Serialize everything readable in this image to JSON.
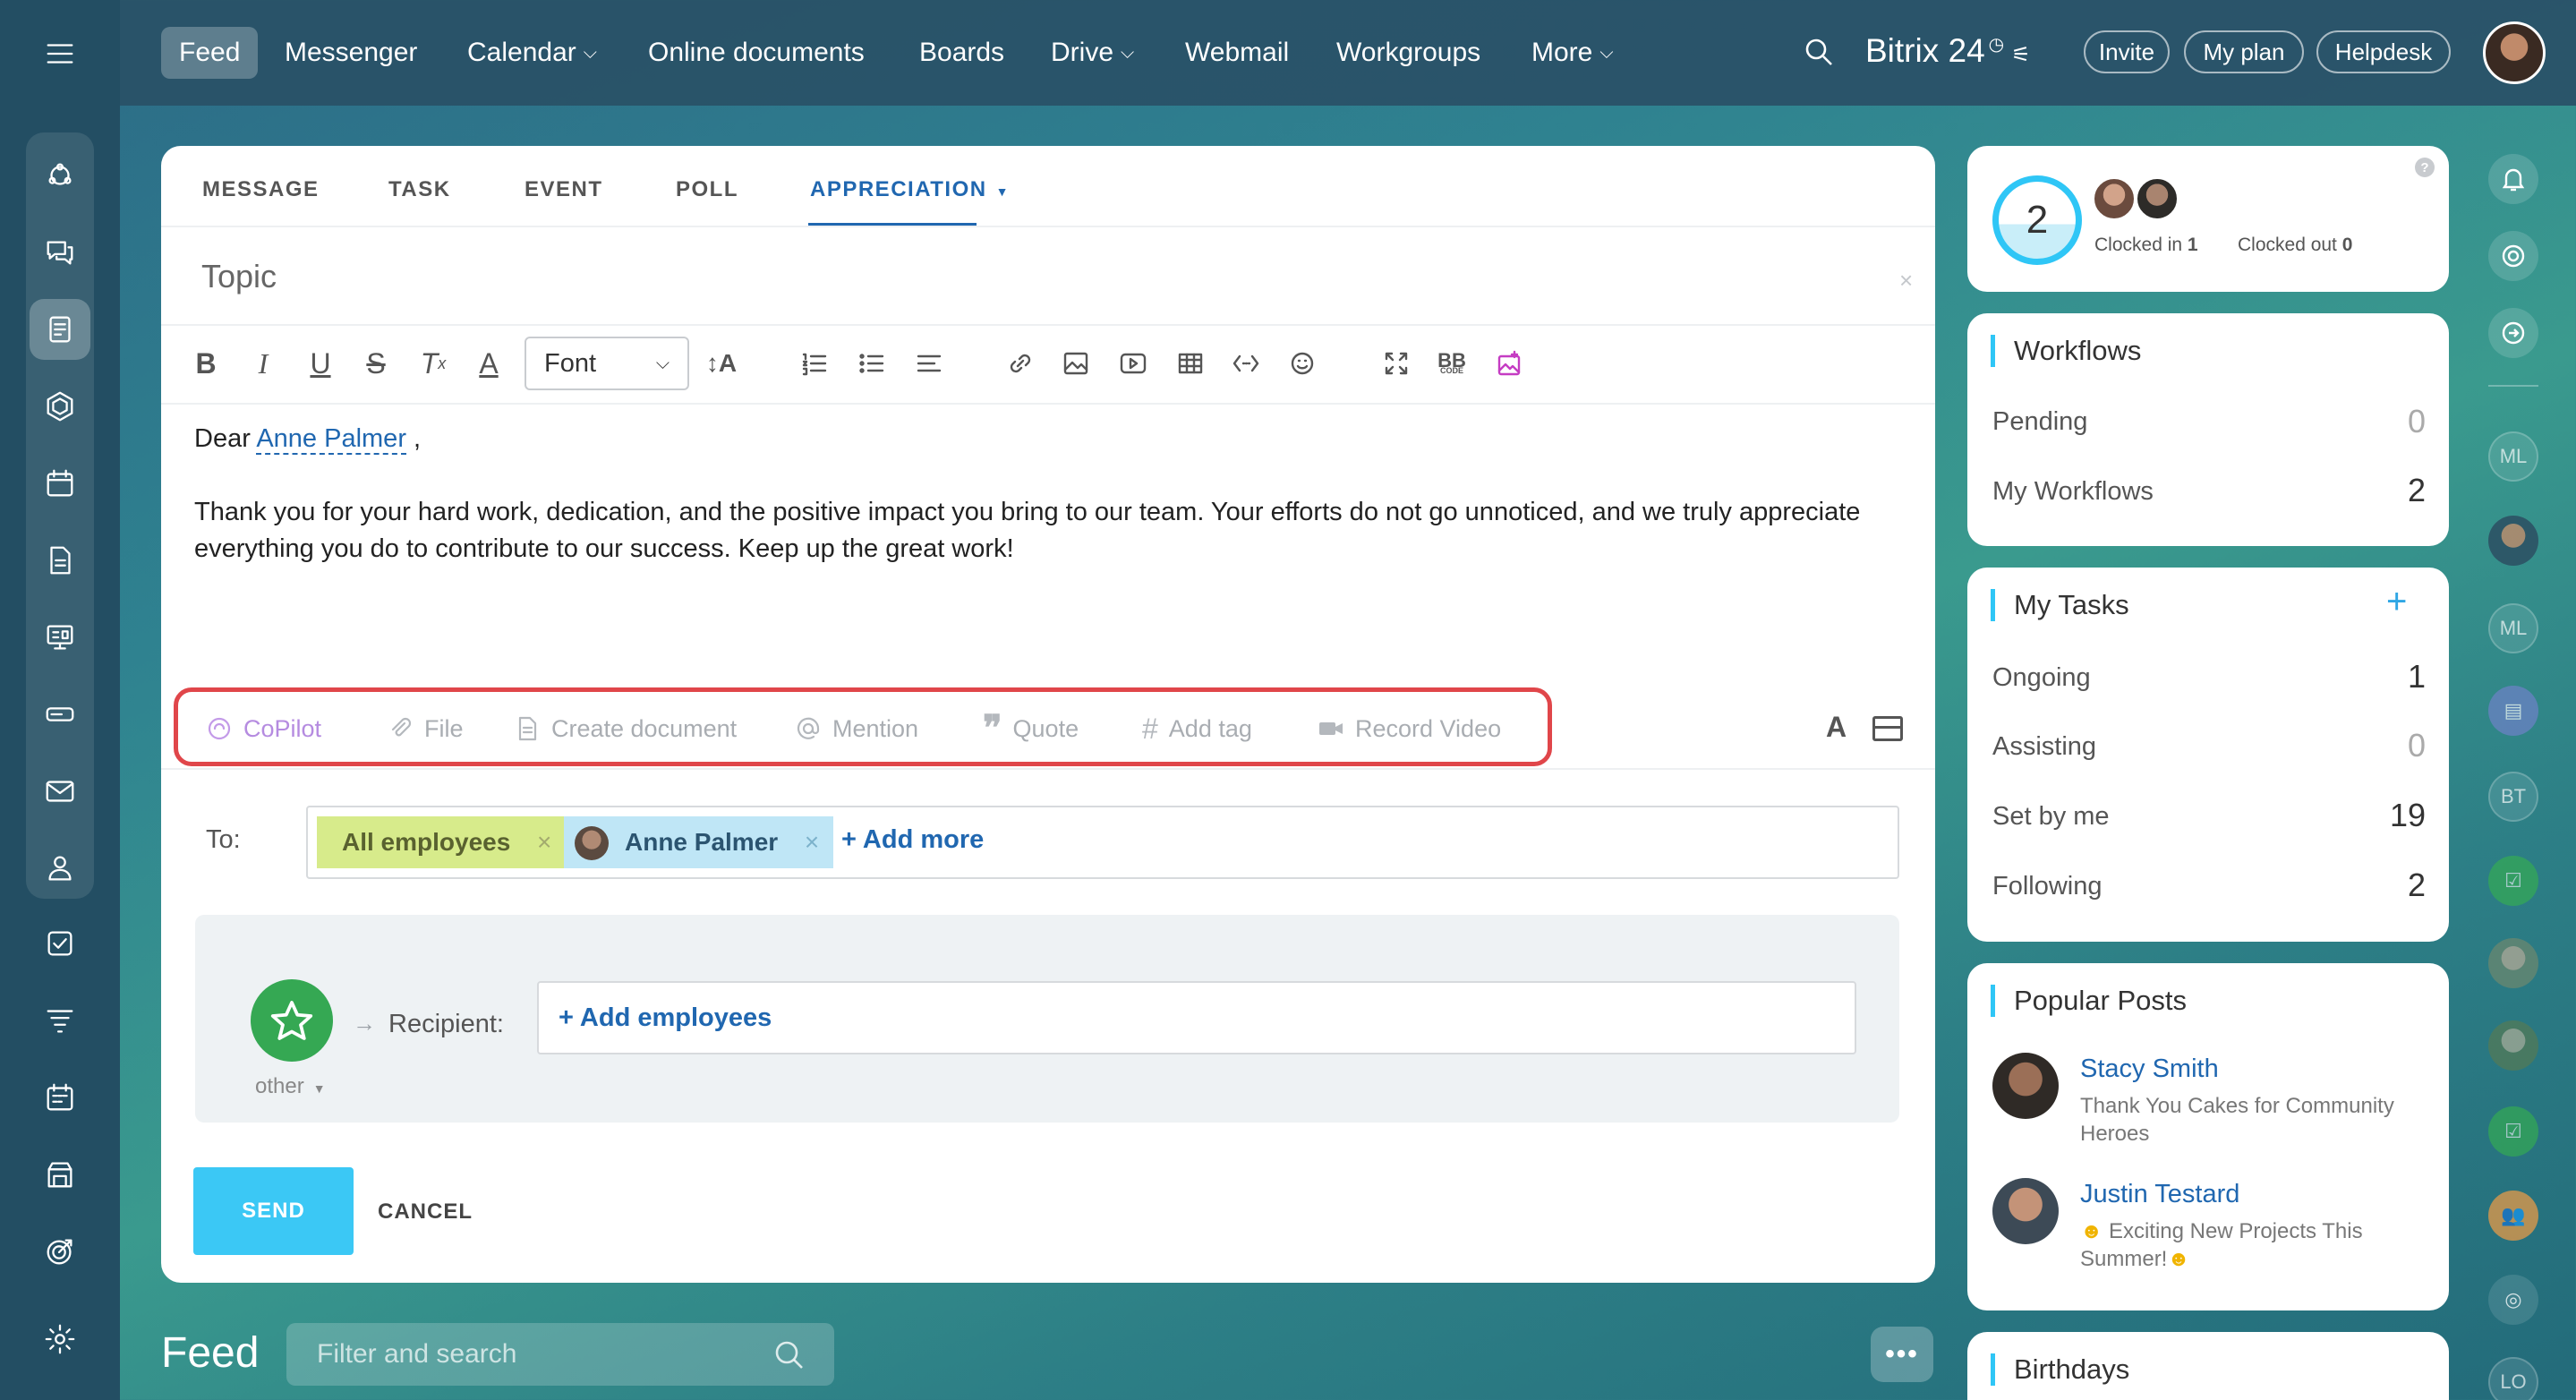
{
  "topnav": {
    "items": [
      "Feed",
      "Messenger",
      "Calendar",
      "Online documents",
      "Boards",
      "Drive",
      "Webmail",
      "Workgroups",
      "More"
    ],
    "brand": "Bitrix 24",
    "invite": "Invite",
    "my_plan": "My plan",
    "helpdesk": "Helpdesk"
  },
  "post_form": {
    "tabs": [
      "MESSAGE",
      "TASK",
      "EVENT",
      "POLL",
      "APPRECIATION"
    ],
    "topic_placeholder": "Topic",
    "font_select": "Font",
    "body": {
      "greeting": "Dear",
      "mention": "Anne Palmer",
      "comma": ",",
      "text": "Thank you for your hard work, dedication, and the positive impact you bring to our team. Your efforts do not go unnoticed, and we truly appreciate everything you do to contribute to our success. Keep up the great work!"
    },
    "bottom_tools": [
      "CoPilot",
      "File",
      "Create document",
      "Mention",
      "Quote",
      "Add tag",
      "Record Video"
    ],
    "to_label": "To:",
    "recipients": [
      "All employees",
      "Anne Palmer"
    ],
    "add_more": "+ Add more",
    "badge_type": "other",
    "recipient_label": "Recipient:",
    "add_employees": "+ Add employees",
    "send": "SEND",
    "cancel": "CANCEL"
  },
  "feed": {
    "title": "Feed",
    "search_placeholder": "Filter and search"
  },
  "time_widget": {
    "count": "2",
    "clocked_in_label": "Clocked in",
    "clocked_in": "1",
    "clocked_out_label": "Clocked out",
    "clocked_out": "0"
  },
  "workflows": {
    "title": "Workflows",
    "rows": [
      {
        "label": "Pending",
        "value": "0"
      },
      {
        "label": "My Workflows",
        "value": "2"
      }
    ]
  },
  "my_tasks": {
    "title": "My Tasks",
    "rows": [
      {
        "label": "Ongoing",
        "value": "1"
      },
      {
        "label": "Assisting",
        "value": "0"
      },
      {
        "label": "Set by me",
        "value": "19"
      },
      {
        "label": "Following",
        "value": "2"
      }
    ]
  },
  "popular_posts": {
    "title": "Popular Posts",
    "posts": [
      {
        "author": "Stacy Smith",
        "title": "Thank You Cakes for Community Heroes"
      },
      {
        "author": "Justin Testard",
        "title": "Exciting New Projects This Summer!"
      }
    ]
  },
  "birthdays": {
    "title": "Birthdays"
  },
  "right_bar": {
    "initials": [
      "ML",
      "ML",
      "BT",
      "LO"
    ]
  },
  "colors": {
    "accent": "#2067b0",
    "send": "#3bc8f5",
    "highlight": "#e0464a",
    "tag_all": "#d7eb8b",
    "tag_user": "#bfe6f6",
    "star": "#35a853"
  }
}
